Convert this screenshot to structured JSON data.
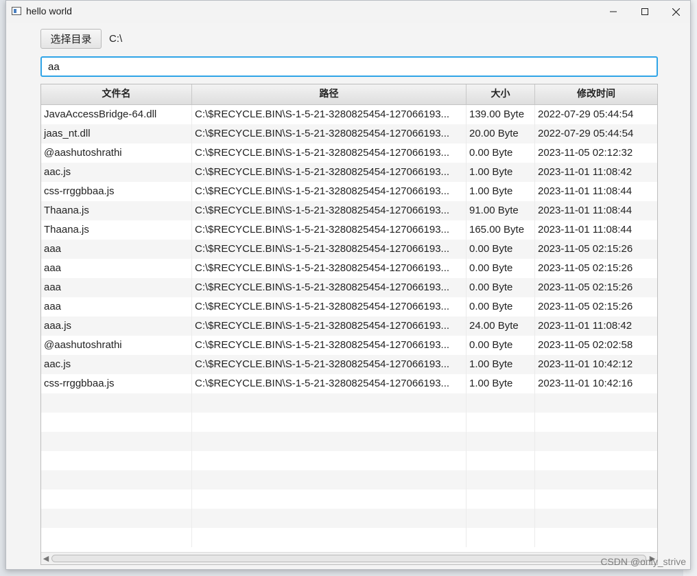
{
  "window": {
    "title": "hello world"
  },
  "toolbar": {
    "select_label": "选择目录",
    "directory": "C:\\"
  },
  "search": {
    "value": "aa"
  },
  "table": {
    "columns": [
      "文件名",
      "路径",
      "大小",
      "修改时间"
    ],
    "rows": [
      [
        "JavaAccessBridge-64.dll",
        "C:\\$RECYCLE.BIN\\S-1-5-21-3280825454-127066193...",
        "139.00 Byte",
        "2022-07-29 05:44:54"
      ],
      [
        "jaas_nt.dll",
        "C:\\$RECYCLE.BIN\\S-1-5-21-3280825454-127066193...",
        "20.00 Byte",
        "2022-07-29 05:44:54"
      ],
      [
        "@aashutoshrathi",
        "C:\\$RECYCLE.BIN\\S-1-5-21-3280825454-127066193...",
        "0.00 Byte",
        "2023-11-05 02:12:32"
      ],
      [
        "aac.js",
        "C:\\$RECYCLE.BIN\\S-1-5-21-3280825454-127066193...",
        "1.00 Byte",
        "2023-11-01 11:08:42"
      ],
      [
        "css-rrggbbaa.js",
        "C:\\$RECYCLE.BIN\\S-1-5-21-3280825454-127066193...",
        "1.00 Byte",
        "2023-11-01 11:08:44"
      ],
      [
        "Thaana.js",
        "C:\\$RECYCLE.BIN\\S-1-5-21-3280825454-127066193...",
        "91.00 Byte",
        "2023-11-01 11:08:44"
      ],
      [
        "Thaana.js",
        "C:\\$RECYCLE.BIN\\S-1-5-21-3280825454-127066193...",
        "165.00 Byte",
        "2023-11-01 11:08:44"
      ],
      [
        "aaa",
        "C:\\$RECYCLE.BIN\\S-1-5-21-3280825454-127066193...",
        "0.00 Byte",
        "2023-11-05 02:15:26"
      ],
      [
        "aaa",
        "C:\\$RECYCLE.BIN\\S-1-5-21-3280825454-127066193...",
        "0.00 Byte",
        "2023-11-05 02:15:26"
      ],
      [
        "aaa",
        "C:\\$RECYCLE.BIN\\S-1-5-21-3280825454-127066193...",
        "0.00 Byte",
        "2023-11-05 02:15:26"
      ],
      [
        "aaa",
        "C:\\$RECYCLE.BIN\\S-1-5-21-3280825454-127066193...",
        "0.00 Byte",
        "2023-11-05 02:15:26"
      ],
      [
        "aaa.js",
        "C:\\$RECYCLE.BIN\\S-1-5-21-3280825454-127066193...",
        "24.00 Byte",
        "2023-11-01 11:08:42"
      ],
      [
        "@aashutoshrathi",
        "C:\\$RECYCLE.BIN\\S-1-5-21-3280825454-127066193...",
        "0.00 Byte",
        "2023-11-05 02:02:58"
      ],
      [
        "aac.js",
        "C:\\$RECYCLE.BIN\\S-1-5-21-3280825454-127066193...",
        "1.00 Byte",
        "2023-11-01 10:42:12"
      ],
      [
        "css-rrggbbaa.js",
        "C:\\$RECYCLE.BIN\\S-1-5-21-3280825454-127066193...",
        "1.00 Byte",
        "2023-11-01 10:42:16"
      ]
    ]
  },
  "watermark": "CSDN @only_strive",
  "colors": {
    "focus_border": "#2fa4e7",
    "row_alt": "#f5f5f5"
  },
  "icons": {
    "app": "app-window-icon",
    "minimize": "minimize-icon",
    "maximize": "maximize-icon",
    "close": "close-icon"
  }
}
